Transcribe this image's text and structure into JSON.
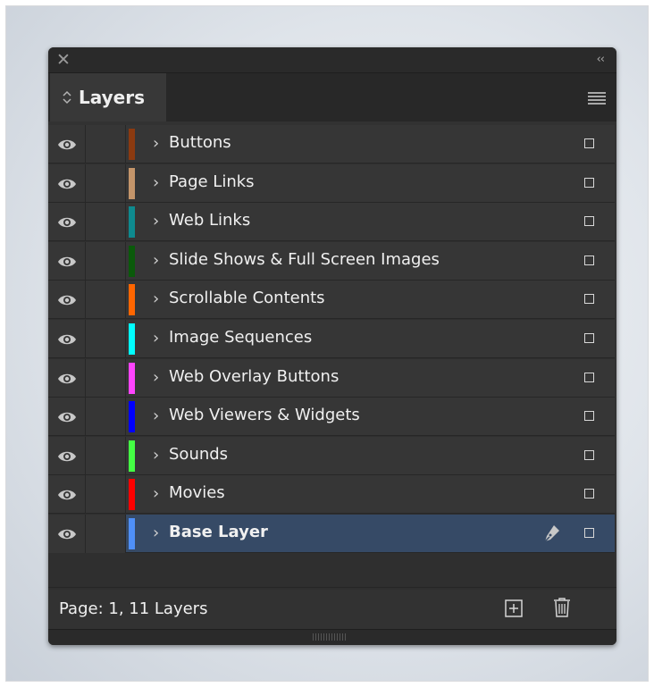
{
  "panel": {
    "close_glyph": "✕",
    "collapse_glyph": "‹‹",
    "tab_label": "Layers",
    "menu_icon": "hamburger-menu-icon"
  },
  "layers": [
    {
      "name": "Buttons",
      "color": "#8b3a10",
      "selected": false
    },
    {
      "name": "Page Links",
      "color": "#c4956a",
      "selected": false
    },
    {
      "name": "Web Links",
      "color": "#0e8a8f",
      "selected": false
    },
    {
      "name": "Slide Shows & Full Screen Images",
      "color": "#0a5a0a",
      "selected": false
    },
    {
      "name": "Scrollable Contents",
      "color": "#ff6600",
      "selected": false
    },
    {
      "name": "Image Sequences",
      "color": "#00ffff",
      "selected": false
    },
    {
      "name": "Web Overlay Buttons",
      "color": "#ff44ff",
      "selected": false
    },
    {
      "name": "Web Viewers & Widgets",
      "color": "#0000ff",
      "selected": false
    },
    {
      "name": "Sounds",
      "color": "#44ff44",
      "selected": false
    },
    {
      "name": "Movies",
      "color": "#ff0000",
      "selected": false
    },
    {
      "name": "Base Layer",
      "color": "#4f8ff7",
      "selected": true
    }
  ],
  "footer": {
    "status": "Page: 1, 11 Layers",
    "new_layer_icon": "new-layer-icon",
    "delete_icon": "trash-icon"
  }
}
